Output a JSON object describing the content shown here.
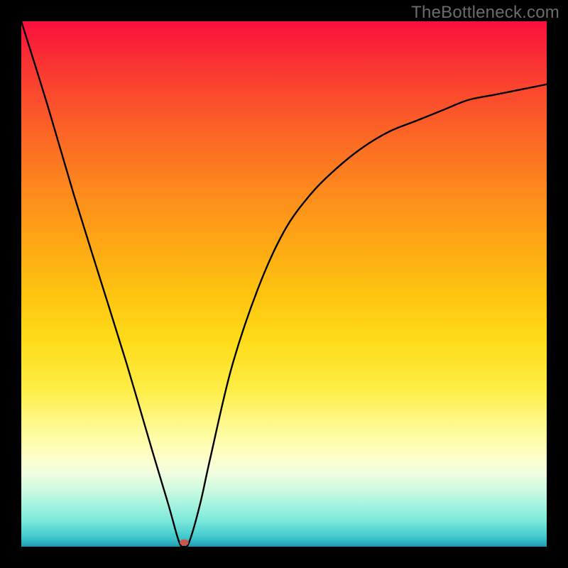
{
  "watermark": "TheBottleneck.com",
  "chart_data": {
    "type": "line",
    "title": "",
    "xlabel": "",
    "ylabel": "",
    "xlim": [
      0,
      100
    ],
    "ylim": [
      0,
      100
    ],
    "grid": false,
    "legend": "none",
    "series": [
      {
        "name": "bottleneck-curve",
        "color": "#000000",
        "x": [
          0,
          5,
          10,
          15,
          20,
          25,
          28,
          30,
          31,
          32,
          34,
          36,
          40,
          45,
          50,
          55,
          60,
          65,
          70,
          75,
          80,
          85,
          90,
          95,
          100
        ],
        "values": [
          100,
          84,
          67,
          51,
          35,
          18,
          8,
          1,
          0,
          1,
          8,
          17,
          34,
          49,
          60,
          67,
          72,
          76,
          79,
          81,
          83,
          85,
          86,
          87,
          88
        ]
      }
    ],
    "marker": {
      "name": "min-marker",
      "x": 31,
      "y": 0.8,
      "rx_pct": 0.85,
      "ry_pct": 0.6,
      "fill": "#d0544a"
    }
  }
}
